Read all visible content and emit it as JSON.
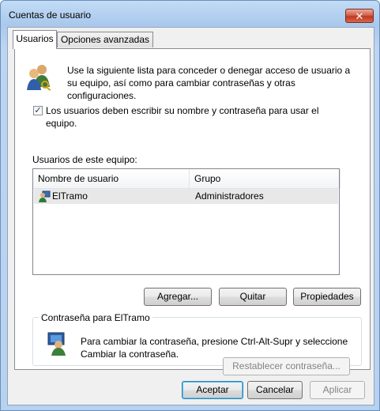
{
  "window": {
    "title": "Cuentas de usuario",
    "close_glyph": "✕"
  },
  "tabs": [
    {
      "label": "Usuarios",
      "active": true
    },
    {
      "label": "Opciones avanzadas",
      "active": false
    }
  ],
  "intro_text": "Use la siguiente lista para conceder o denegar acceso de usuario a su equipo, así como para cambiar contraseñas y otras configuraciones.",
  "checkbox": {
    "checked": true,
    "mark": "✓",
    "label": "Los usuarios deben escribir su nombre y contraseña para usar el equipo."
  },
  "users_label": "Usuarios de este equipo:",
  "user_table": {
    "columns": [
      "Nombre de usuario",
      "Grupo"
    ],
    "rows": [
      {
        "name": "ElTramo",
        "group": "Administradores"
      }
    ]
  },
  "list_buttons": {
    "add": "Agregar...",
    "remove": "Quitar",
    "properties": "Propiedades"
  },
  "password_group": {
    "title": "Contraseña para ElTramo",
    "text": "Para cambiar la contraseña, presione Ctrl-Alt-Supr y seleccione Cambiar la contraseña.",
    "reset_button": "Restablecer contraseña..."
  },
  "dialog_buttons": {
    "ok": "Aceptar",
    "cancel": "Cancelar",
    "apply": "Aplicar"
  },
  "icons": {
    "users": "users-icon",
    "user_row": "user-icon",
    "password": "user-computer-icon"
  }
}
